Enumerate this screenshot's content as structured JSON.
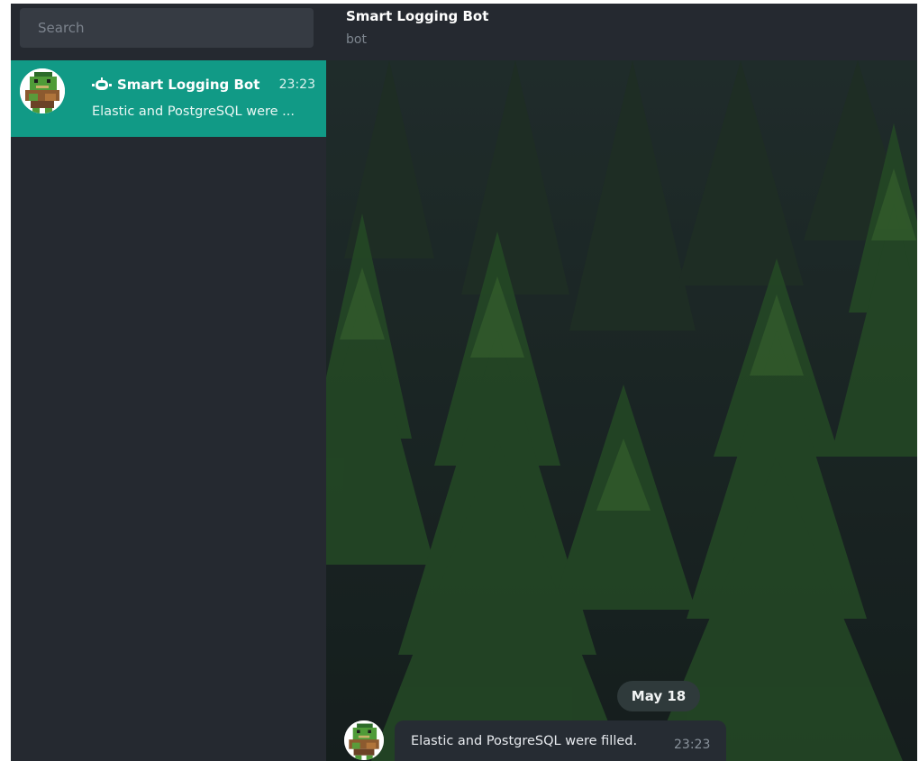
{
  "search": {
    "placeholder": "Search"
  },
  "chat_list": [
    {
      "title": "Smart Logging Bot",
      "time": "23:23",
      "preview": "Elastic and PostgreSQL were ...",
      "icon": "bot-icon",
      "avatar": "orc-pixel-avatar",
      "selected": true
    }
  ],
  "header": {
    "title": "Smart Logging Bot",
    "subtitle": "bot"
  },
  "messages": {
    "date_label": "May 18",
    "items": [
      {
        "text": "Elastic and PostgreSQL were filled.",
        "time": "23:23",
        "avatar": "orc-pixel-avatar"
      }
    ]
  },
  "colors": {
    "sidebar_bg": "#252930",
    "selected_chat_bg": "#119a86",
    "header_bg": "#252930",
    "bubble_bg": "#262c33",
    "wallpaper_dark": "#1c2326",
    "wallpaper_trees": "#3f7a2f"
  }
}
